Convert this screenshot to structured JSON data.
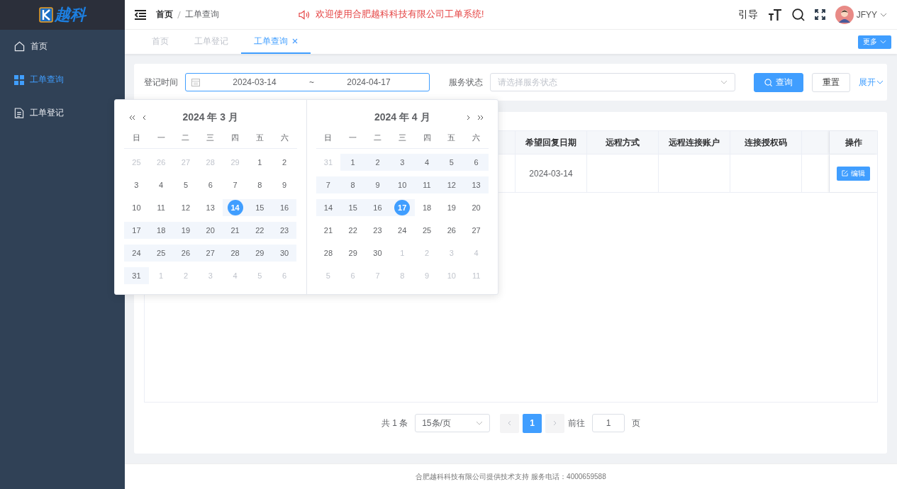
{
  "logo": {
    "text": "越科"
  },
  "sidebar": {
    "items": [
      {
        "label": "首页",
        "kind": "home",
        "selected": false
      },
      {
        "label": "工单查询",
        "kind": "grid",
        "selected": true
      },
      {
        "label": "工单登记",
        "kind": "doc",
        "selected": false
      }
    ]
  },
  "header": {
    "breadcrumb": [
      "首页",
      "工单查询"
    ],
    "notice": "欢迎使用合肥越科科技有限公司工单系统!",
    "guide": "引导",
    "user": "JFYY"
  },
  "tabs": [
    {
      "label": "首页",
      "selected": false,
      "closable": false
    },
    {
      "label": "工单登记",
      "selected": false,
      "closable": false
    },
    {
      "label": "工单查询",
      "selected": true,
      "closable": true
    }
  ],
  "more_button": "更多",
  "search": {
    "date_label": "登记时间",
    "start": "2024-03-14",
    "separator": "~",
    "end": "2024-04-17",
    "status_label": "服务状态",
    "status_placeholder": "请选择服务状态",
    "query": "查询",
    "reset": "重置",
    "expand": "展开"
  },
  "calendar": {
    "months": [
      {
        "title": "2024 年 3 月",
        "weekdays": [
          "日",
          "一",
          "二",
          "三",
          "四",
          "五",
          "六"
        ],
        "weeks": [
          {
            "days": [
              {
                "day": "25",
                "outside": true,
                "in_range": false,
                "selected": false
              },
              {
                "day": "26",
                "outside": true,
                "in_range": false,
                "selected": false
              },
              {
                "day": "27",
                "outside": true,
                "in_range": false,
                "selected": false
              },
              {
                "day": "28",
                "outside": true,
                "in_range": false,
                "selected": false
              },
              {
                "day": "29",
                "outside": true,
                "in_range": false,
                "selected": false
              },
              {
                "day": "1",
                "outside": false,
                "in_range": false,
                "selected": false
              },
              {
                "day": "2",
                "outside": false,
                "in_range": false,
                "selected": false
              }
            ]
          },
          {
            "days": [
              {
                "day": "3",
                "outside": false,
                "in_range": false,
                "selected": false
              },
              {
                "day": "4",
                "outside": false,
                "in_range": false,
                "selected": false
              },
              {
                "day": "5",
                "outside": false,
                "in_range": false,
                "selected": false
              },
              {
                "day": "6",
                "outside": false,
                "in_range": false,
                "selected": false
              },
              {
                "day": "7",
                "outside": false,
                "in_range": false,
                "selected": false
              },
              {
                "day": "8",
                "outside": false,
                "in_range": false,
                "selected": false
              },
              {
                "day": "9",
                "outside": false,
                "in_range": false,
                "selected": false
              }
            ]
          },
          {
            "days": [
              {
                "day": "10",
                "outside": false,
                "in_range": false,
                "selected": false
              },
              {
                "day": "11",
                "outside": false,
                "in_range": false,
                "selected": false
              },
              {
                "day": "12",
                "outside": false,
                "in_range": false,
                "selected": false
              },
              {
                "day": "13",
                "outside": false,
                "in_range": false,
                "selected": false
              },
              {
                "day": "14",
                "outside": false,
                "in_range": true,
                "selected": true
              },
              {
                "day": "15",
                "outside": false,
                "in_range": true,
                "selected": false
              },
              {
                "day": "16",
                "outside": false,
                "in_range": true,
                "selected": false
              }
            ]
          },
          {
            "days": [
              {
                "day": "17",
                "outside": false,
                "in_range": true,
                "selected": false
              },
              {
                "day": "18",
                "outside": false,
                "in_range": true,
                "selected": false
              },
              {
                "day": "19",
                "outside": false,
                "in_range": true,
                "selected": false
              },
              {
                "day": "20",
                "outside": false,
                "in_range": true,
                "selected": false
              },
              {
                "day": "21",
                "outside": false,
                "in_range": true,
                "selected": false
              },
              {
                "day": "22",
                "outside": false,
                "in_range": true,
                "selected": false
              },
              {
                "day": "23",
                "outside": false,
                "in_range": true,
                "selected": false
              }
            ]
          },
          {
            "days": [
              {
                "day": "24",
                "outside": false,
                "in_range": true,
                "selected": false
              },
              {
                "day": "25",
                "outside": false,
                "in_range": true,
                "selected": false
              },
              {
                "day": "26",
                "outside": false,
                "in_range": true,
                "selected": false
              },
              {
                "day": "27",
                "outside": false,
                "in_range": true,
                "selected": false
              },
              {
                "day": "28",
                "outside": false,
                "in_range": true,
                "selected": false
              },
              {
                "day": "29",
                "outside": false,
                "in_range": true,
                "selected": false
              },
              {
                "day": "30",
                "outside": false,
                "in_range": true,
                "selected": false
              }
            ]
          },
          {
            "days": [
              {
                "day": "31",
                "outside": false,
                "in_range": true,
                "selected": false
              },
              {
                "day": "1",
                "outside": true,
                "in_range": false,
                "selected": false
              },
              {
                "day": "2",
                "outside": true,
                "in_range": false,
                "selected": false
              },
              {
                "day": "3",
                "outside": true,
                "in_range": false,
                "selected": false
              },
              {
                "day": "4",
                "outside": true,
                "in_range": false,
                "selected": false
              },
              {
                "day": "5",
                "outside": true,
                "in_range": false,
                "selected": false
              },
              {
                "day": "6",
                "outside": true,
                "in_range": false,
                "selected": false
              }
            ]
          }
        ]
      },
      {
        "title": "2024 年 4 月",
        "weekdays": [
          "日",
          "一",
          "二",
          "三",
          "四",
          "五",
          "六"
        ],
        "weeks": [
          {
            "days": [
              {
                "day": "31",
                "outside": true,
                "in_range": false,
                "selected": false
              },
              {
                "day": "1",
                "outside": false,
                "in_range": true,
                "selected": false
              },
              {
                "day": "2",
                "outside": false,
                "in_range": true,
                "selected": false
              },
              {
                "day": "3",
                "outside": false,
                "in_range": true,
                "selected": false
              },
              {
                "day": "4",
                "outside": false,
                "in_range": true,
                "selected": false
              },
              {
                "day": "5",
                "outside": false,
                "in_range": true,
                "selected": false
              },
              {
                "day": "6",
                "outside": false,
                "in_range": true,
                "selected": false
              }
            ]
          },
          {
            "days": [
              {
                "day": "7",
                "outside": false,
                "in_range": true,
                "selected": false
              },
              {
                "day": "8",
                "outside": false,
                "in_range": true,
                "selected": false
              },
              {
                "day": "9",
                "outside": false,
                "in_range": true,
                "selected": false
              },
              {
                "day": "10",
                "outside": false,
                "in_range": true,
                "selected": false
              },
              {
                "day": "11",
                "outside": false,
                "in_range": true,
                "selected": false
              },
              {
                "day": "12",
                "outside": false,
                "in_range": true,
                "selected": false
              },
              {
                "day": "13",
                "outside": false,
                "in_range": true,
                "selected": false
              }
            ]
          },
          {
            "days": [
              {
                "day": "14",
                "outside": false,
                "in_range": true,
                "selected": false
              },
              {
                "day": "15",
                "outside": false,
                "in_range": true,
                "selected": false
              },
              {
                "day": "16",
                "outside": false,
                "in_range": true,
                "selected": false
              },
              {
                "day": "17",
                "outside": false,
                "in_range": true,
                "selected": true
              },
              {
                "day": "18",
                "outside": false,
                "in_range": false,
                "selected": false
              },
              {
                "day": "19",
                "outside": false,
                "in_range": false,
                "selected": false
              },
              {
                "day": "20",
                "outside": false,
                "in_range": false,
                "selected": false
              }
            ]
          },
          {
            "days": [
              {
                "day": "21",
                "outside": false,
                "in_range": false,
                "selected": false
              },
              {
                "day": "22",
                "outside": false,
                "in_range": false,
                "selected": false
              },
              {
                "day": "23",
                "outside": false,
                "in_range": false,
                "selected": false
              },
              {
                "day": "24",
                "outside": false,
                "in_range": false,
                "selected": false
              },
              {
                "day": "25",
                "outside": false,
                "in_range": false,
                "selected": false
              },
              {
                "day": "26",
                "outside": false,
                "in_range": false,
                "selected": false
              },
              {
                "day": "27",
                "outside": false,
                "in_range": false,
                "selected": false
              }
            ]
          },
          {
            "days": [
              {
                "day": "28",
                "outside": false,
                "in_range": false,
                "selected": false
              },
              {
                "day": "29",
                "outside": false,
                "in_range": false,
                "selected": false
              },
              {
                "day": "30",
                "outside": false,
                "in_range": false,
                "selected": false
              },
              {
                "day": "1",
                "outside": true,
                "in_range": false,
                "selected": false
              },
              {
                "day": "2",
                "outside": true,
                "in_range": false,
                "selected": false
              },
              {
                "day": "3",
                "outside": true,
                "in_range": false,
                "selected": false
              },
              {
                "day": "4",
                "outside": true,
                "in_range": false,
                "selected": false
              }
            ]
          },
          {
            "days": [
              {
                "day": "5",
                "outside": true,
                "in_range": false,
                "selected": false
              },
              {
                "day": "6",
                "outside": true,
                "in_range": false,
                "selected": false
              },
              {
                "day": "7",
                "outside": true,
                "in_range": false,
                "selected": false
              },
              {
                "day": "8",
                "outside": true,
                "in_range": false,
                "selected": false
              },
              {
                "day": "9",
                "outside": true,
                "in_range": false,
                "selected": false
              },
              {
                "day": "10",
                "outside": true,
                "in_range": false,
                "selected": false
              },
              {
                "day": "11",
                "outside": true,
                "in_range": false,
                "selected": false
              }
            ]
          }
        ]
      }
    ]
  },
  "table": {
    "columns": [
      {
        "label": "希望回复日期"
      },
      {
        "label": "远程方式"
      },
      {
        "label": "远程连接账户"
      },
      {
        "label": "连接授权码"
      }
    ],
    "action_column": "操作",
    "rows": [
      {
        "cells": [
          "2024-03-14"
        ],
        "action": "编辑"
      }
    ]
  },
  "pagination": {
    "total": "共 1 条",
    "page_size": "15条/页",
    "current": "1",
    "goto_label": "前往",
    "goto_value": "1",
    "page_unit": "页"
  },
  "footer": "合肥越科科技有限公司提供技术支持 服务电话：4000659588"
}
